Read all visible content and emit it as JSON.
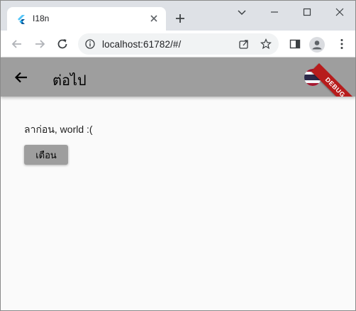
{
  "browser": {
    "tab": {
      "title": "I18n"
    },
    "address": {
      "url": "localhost:61782/#/"
    }
  },
  "app": {
    "title": "ต่อไป",
    "greeting": "ลาก่อน, world :(",
    "alert_button_label": "เตือน",
    "debug_banner": "DEBUG"
  },
  "colors": {
    "appbar": "#9e9e9e",
    "debug_banner": "#b71c1c",
    "tabstrip": "#dee1e6"
  }
}
